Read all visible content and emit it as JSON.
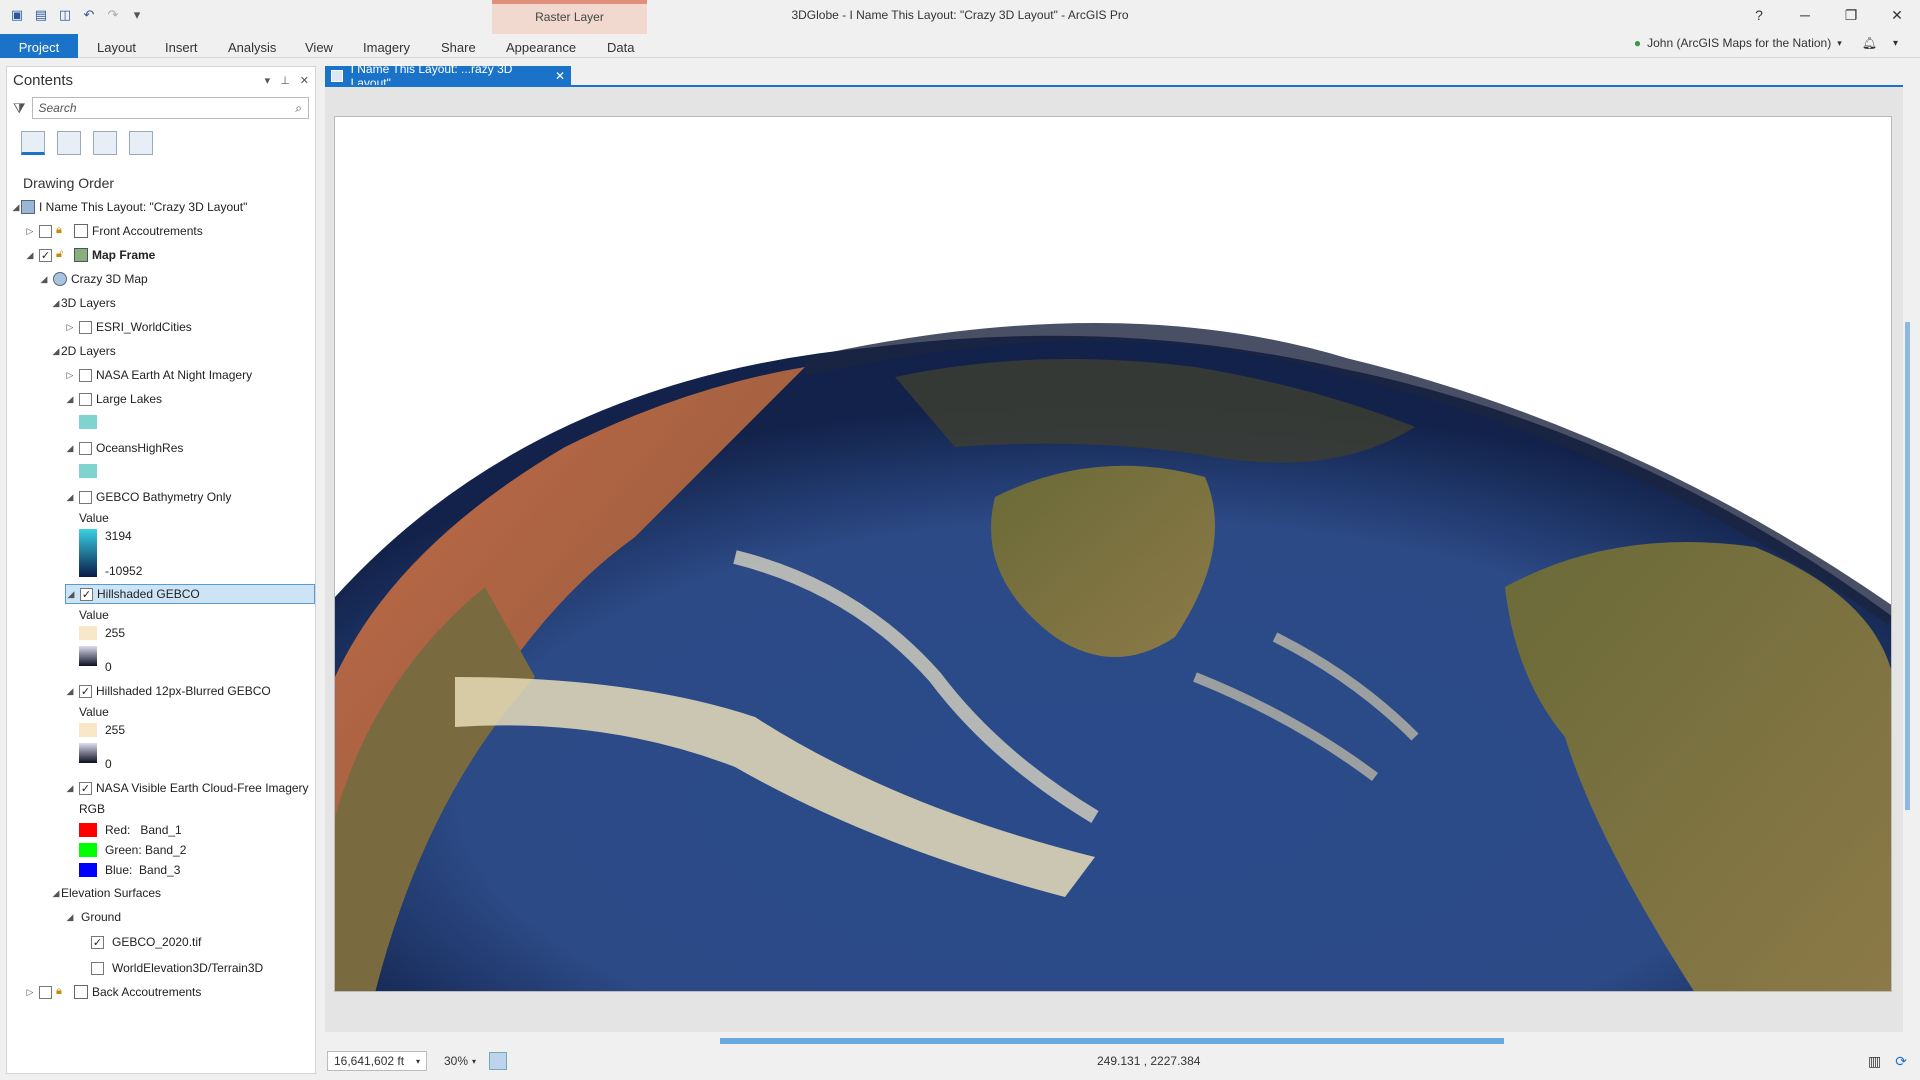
{
  "app": {
    "window_title": "3DGlobe - I Name This Layout: \"Crazy 3D Layout\" - ArcGIS Pro",
    "context_group": "Raster Layer",
    "help": "?",
    "minimize": "─",
    "maximize": "❐",
    "close": "✕"
  },
  "ribbon": {
    "tabs": [
      "Project",
      "Layout",
      "Insert",
      "Analysis",
      "View",
      "Imagery",
      "Share",
      "Appearance",
      "Data"
    ],
    "user": "John (ArcGIS Maps for the Nation)"
  },
  "contents": {
    "title": "Contents",
    "search_placeholder": "Search",
    "section": "Drawing Order",
    "items": [
      {
        "label": "I Name This Layout: \"Crazy 3D Layout\""
      },
      {
        "label": "Front Accoutrements"
      },
      {
        "label": "Map Frame"
      },
      {
        "label": "Crazy 3D Map"
      },
      {
        "label": "3D Layers"
      },
      {
        "label": "ESRI_WorldCities"
      },
      {
        "label": "2D Layers"
      },
      {
        "label": "NASA Earth At Night Imagery"
      },
      {
        "label": "Large Lakes"
      },
      {
        "label": "OceansHighRes"
      },
      {
        "label": "GEBCO Bathymetry Only"
      },
      {
        "label": "Hillshaded GEBCO"
      },
      {
        "label": "Hillshaded 12px-Blurred GEBCO"
      },
      {
        "label": "NASA Visible Earth Cloud-Free Imagery"
      },
      {
        "label": "Elevation Surfaces"
      },
      {
        "label": "Ground"
      },
      {
        "label": "GEBCO_2020.tif"
      },
      {
        "label": "WorldElevation3D/Terrain3D"
      },
      {
        "label": "Back Accoutrements"
      }
    ],
    "legend": {
      "value_label": "Value",
      "gebco_high": "3194",
      "gebco_low": "-10952",
      "hs_high": "255",
      "hs_low": "0",
      "hs12_high": "255",
      "hs12_low": "0",
      "rgb_label": "RGB",
      "red": "Red:   Band_1",
      "green": "Green: Band_2",
      "blue": "Blue:  Band_3"
    }
  },
  "doc_tab": {
    "label": "I Name This Layout: ...razy 3D Layout\"",
    "close": "✕"
  },
  "status": {
    "scale": "16,641,602 ft",
    "zoom": "30%",
    "coords": "249.131 , 2227.384"
  },
  "colors": {
    "accent": "#1a73c9",
    "lake_swatch": "#7fd4d0",
    "ocean_swatch": "#7fd4d0",
    "red": "#ff0000",
    "green": "#00ff00",
    "blue": "#0000ff"
  }
}
